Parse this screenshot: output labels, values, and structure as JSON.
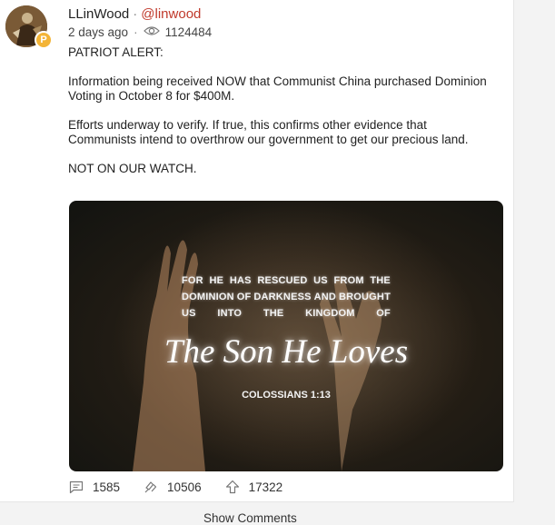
{
  "post": {
    "author_name": "LLinWood",
    "separator": "·",
    "handle": "@linwood",
    "time_ago": "2 days ago",
    "meta_separator": "·",
    "views": "1124484",
    "paragraphs": [
      "PATRIOT ALERT:",
      "Information being received NOW that Communist China purchased Dominion Voting in October 8 for $400M.",
      "Efforts underway to verify. If true, this confirms other evidence that Communists intend to overthrow our government to get our precious land.",
      "NOT ON OUR WATCH."
    ],
    "image": {
      "verse_lines": [
        [
          "FOR",
          "HE",
          "HAS",
          "RESCUED",
          "US",
          "FROM",
          "THE"
        ],
        [
          "DOMINION",
          "OF",
          "DARKNESS",
          "AND",
          "BROUGHT"
        ],
        [
          "US",
          "INTO",
          "THE",
          "KINGDOM",
          "OF"
        ]
      ],
      "title": "The Son He Loves",
      "reference": "COLOSSIANS 1:13"
    },
    "actions": {
      "comments": "1585",
      "reposts": "10506",
      "upvotes": "17322"
    },
    "show_comments": "Show Comments"
  },
  "icons": {
    "avatar_badge": "parler-p-badge-icon",
    "views": "eye-icon",
    "comments": "comment-icon",
    "reposts": "repost-icon",
    "upvotes": "upvote-icon"
  },
  "colors": {
    "handle": "#c0392b",
    "badge": "#f3b437"
  }
}
